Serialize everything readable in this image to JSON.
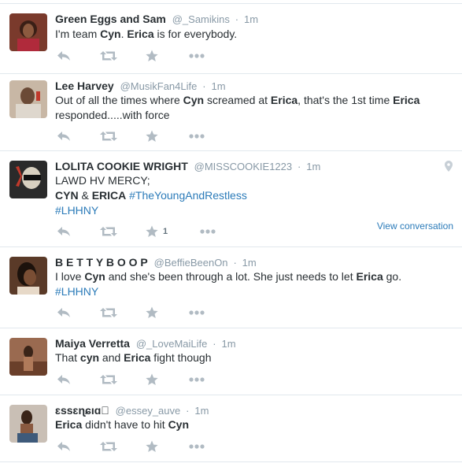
{
  "tweets": [
    {
      "name": "Green Eggs and Sam",
      "handle": "@_Samikins",
      "sep": "·",
      "time": "1m",
      "lines": [
        [
          {
            "t": "I'm team "
          },
          {
            "t": "Cyn",
            "b": true
          },
          {
            "t": ". "
          },
          {
            "t": "Erica",
            "b": true
          },
          {
            "t": " is for everybody."
          }
        ]
      ]
    },
    {
      "name": "Lee Harvey",
      "handle": "@MusikFan4Life",
      "sep": "·",
      "time": "1m",
      "lines": [
        [
          {
            "t": "Out of all the times where "
          },
          {
            "t": "Cyn",
            "b": true
          },
          {
            "t": " screamed at "
          },
          {
            "t": "Erica",
            "b": true
          },
          {
            "t": ", that's the 1st time "
          },
          {
            "t": "Erica",
            "b": true
          }
        ],
        [
          {
            "t": "responded.....with force"
          }
        ]
      ]
    },
    {
      "name": "LOLITA COOKIE WRIGHT",
      "handle": "@MISSCOOKIE1223",
      "sep": "·",
      "time": "1m",
      "lines": [
        [
          {
            "t": "LAWD HV MERCY;"
          }
        ],
        [
          {
            "t": "CYN",
            "b": true
          },
          {
            "t": " & "
          },
          {
            "t": "ERICA",
            "b": true
          },
          {
            "t": "  "
          },
          {
            "t": "#TheYoungAndRestless",
            "h": true
          }
        ],
        [
          {
            "t": "#LHHNY",
            "h": true
          }
        ]
      ],
      "favorite_count": "1",
      "view_conversation": "View conversation",
      "location_icon": "map-pin-icon"
    },
    {
      "name": "B E T T Y B O O P",
      "handle": "@BeffieBeenOn",
      "sep": "·",
      "time": "1m",
      "lines": [
        [
          {
            "t": "I love "
          },
          {
            "t": "Cyn",
            "b": true
          },
          {
            "t": " and she's been through a lot. She just needs to let "
          },
          {
            "t": "Erica",
            "b": true
          },
          {
            "t": " go."
          }
        ],
        [
          {
            "t": "#LHHNY",
            "h": true
          }
        ]
      ]
    },
    {
      "name": "Maiya Verretta",
      "handle": "@_LoveMaiLife",
      "sep": "·",
      "time": "1m",
      "lines": [
        [
          {
            "t": "That "
          },
          {
            "t": "cyn",
            "b": true
          },
          {
            "t": " and "
          },
          {
            "t": "Erica",
            "b": true
          },
          {
            "t": " fight though"
          }
        ]
      ]
    },
    {
      "name": "ɛssɛɳɕıɑ\u0000",
      "handle": "@essey_auve",
      "sep": "·",
      "time": "1m",
      "lines": [
        [
          {
            "t": "Erica",
            "b": true
          },
          {
            "t": " didn't have to hit "
          },
          {
            "t": "Cyn",
            "b": true
          }
        ]
      ]
    }
  ],
  "icons": [
    "reply-icon",
    "retweet-icon",
    "favorite-icon",
    "more-icon"
  ],
  "colors": {
    "icon": "#b1bbc3",
    "link": "#2b7bb9",
    "meta": "#8899a6",
    "divider": "#e1e8ed"
  }
}
